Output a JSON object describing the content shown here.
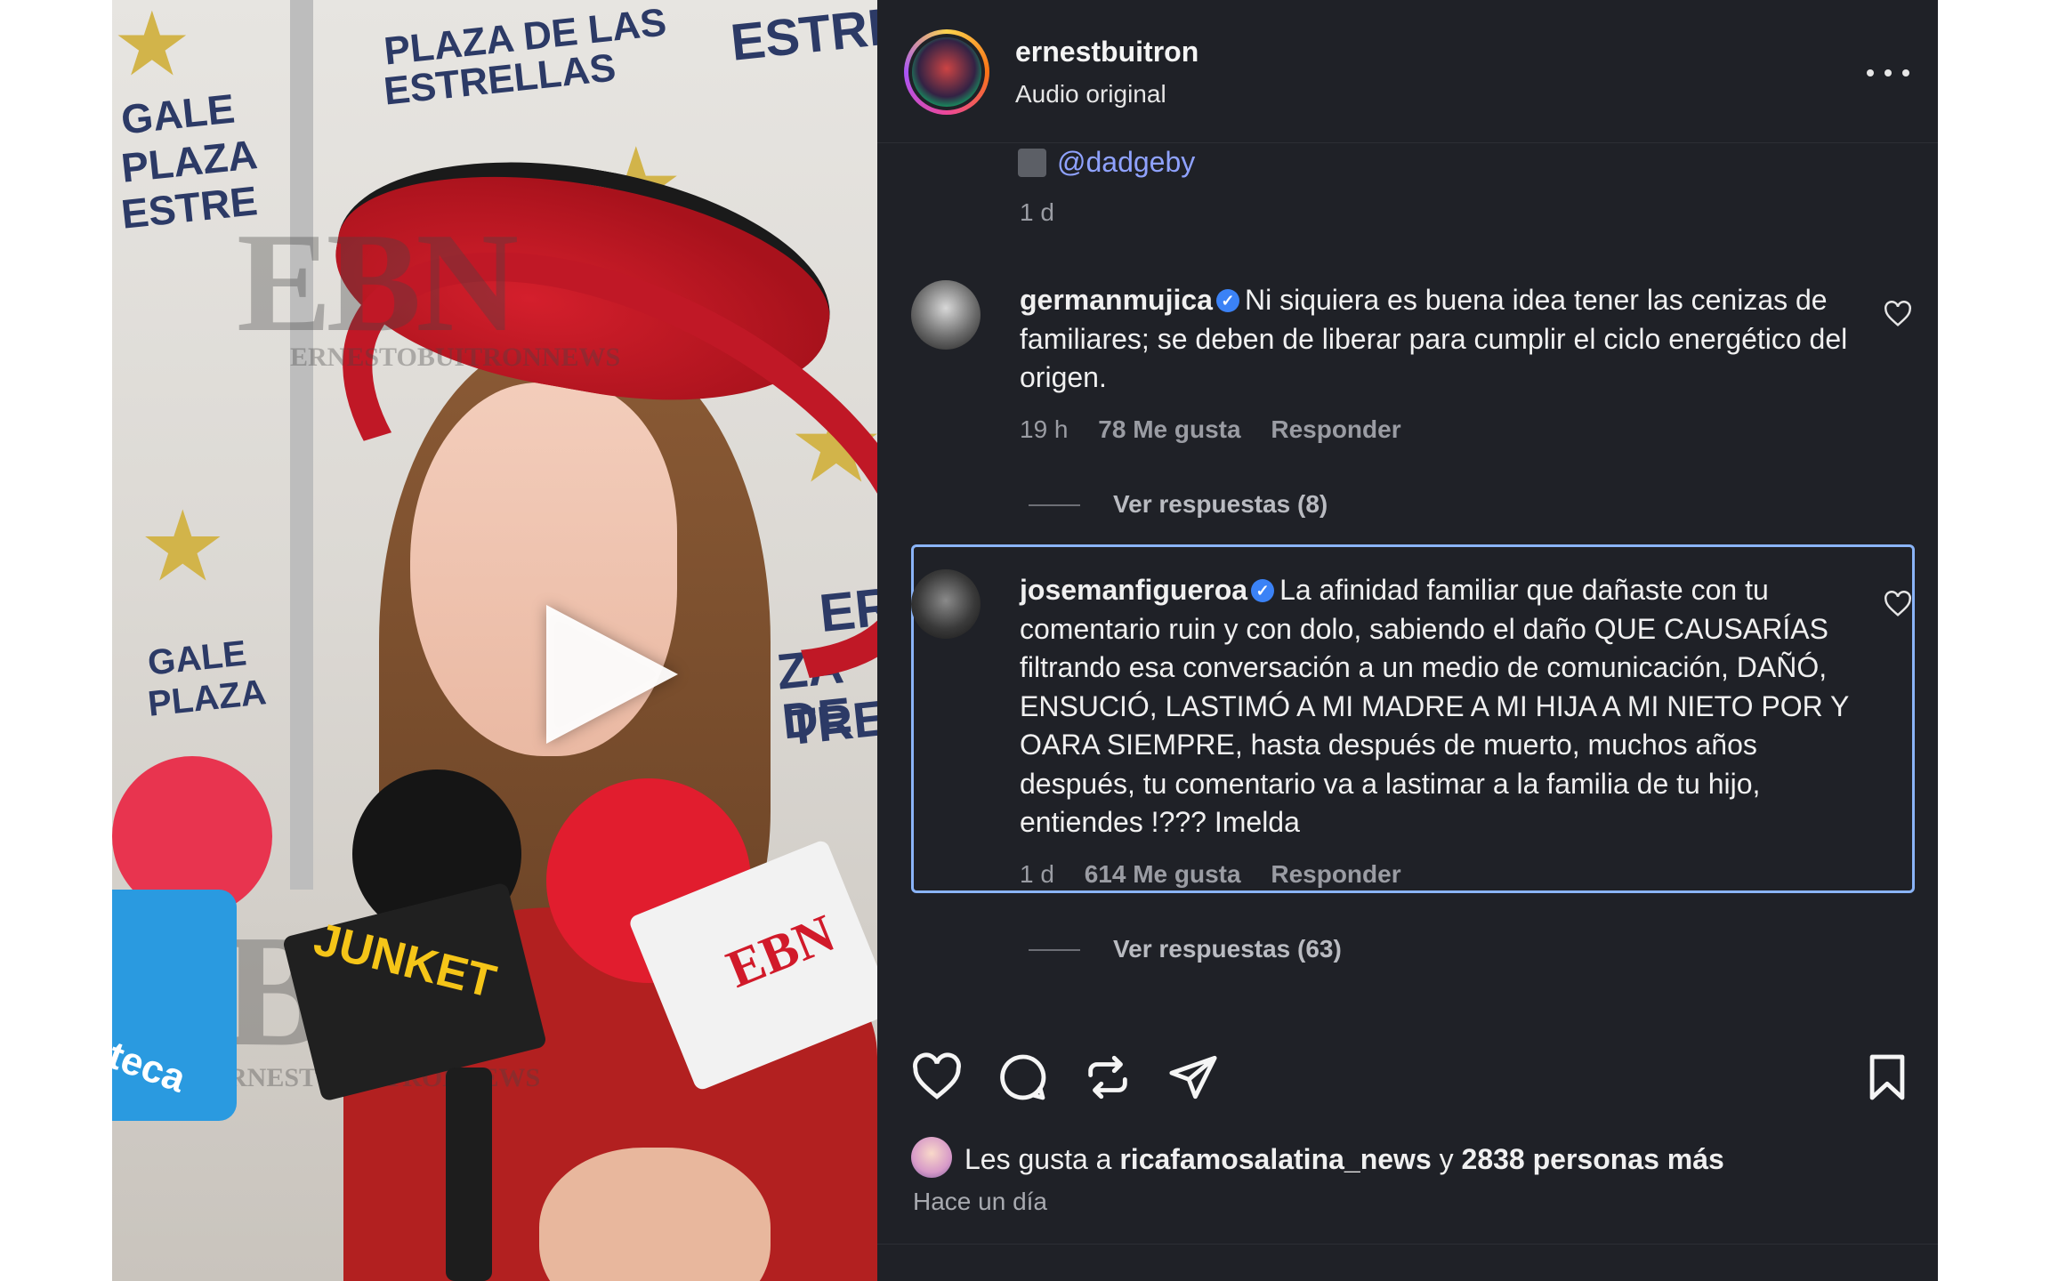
{
  "post": {
    "author": "ernestbuitron",
    "audio": "Audio original",
    "mention": "@dadgeby",
    "caption_time": "1 d"
  },
  "video": {
    "backdrop": [
      "PLAZA DE LAS",
      "ESTRELLAS",
      "ESTREL",
      "GALE",
      "PLAZA",
      "ESTRE",
      "ERI",
      "ZA DE",
      "TRELI",
      "GALE",
      "PLAZA"
    ],
    "watermarks": [
      "EBN",
      "ERNESTOBUITRONNEWS",
      "EBN",
      "ERNESTOBUITRONNEWS"
    ],
    "mic_labels": [
      "JUNKET",
      "EBN",
      "teca"
    ]
  },
  "comments": [
    {
      "username": "germanmujica",
      "verified": true,
      "text": "Ni siquiera es buena idea tener las cenizas de familiares; se deben de liberar para cumplir el ciclo energético del origen.",
      "time": "19 h",
      "likes": "78 Me gusta",
      "reply": "Responder",
      "view_replies": "Ver respuestas (8)"
    },
    {
      "username": "josemanfigueroa",
      "verified": true,
      "text": "La afinidad familiar que dañaste con tu comentario ruin y con dolo, sabiendo el daño QUE CAUSARÍAS filtrando esa conversación a un medio de comunicación, DAÑÓ, ENSUCIÓ, LASTIMÓ A MI MADRE A MI HIJA A MI NIETO POR Y OARA SIEMPRE, hasta después de muerto, muchos años después, tu comentario va a lastimar a la familia de tu hijo, entiendes !??? Imelda",
      "time": "1 d",
      "likes": "614 Me gusta",
      "reply": "Responder",
      "view_replies": "Ver respuestas (63)"
    }
  ],
  "likes_line": {
    "prefix": "Les gusta a",
    "user": "ricafamosalatina_news",
    "mid": "y",
    "count": "2838 personas más"
  },
  "post_time": "Hace un día",
  "icons": {
    "like": "heart-icon",
    "comment": "comment-icon",
    "repost": "repost-icon",
    "share": "send-icon",
    "save": "bookmark-icon",
    "more": "more-options-icon",
    "play": "play-icon",
    "verified": "verified-badge-icon"
  },
  "colors": {
    "panel_bg": "#1f2127",
    "highlight_border": "#8ab4f8",
    "mention": "#8fa2ff",
    "verified": "#3b82f6"
  }
}
